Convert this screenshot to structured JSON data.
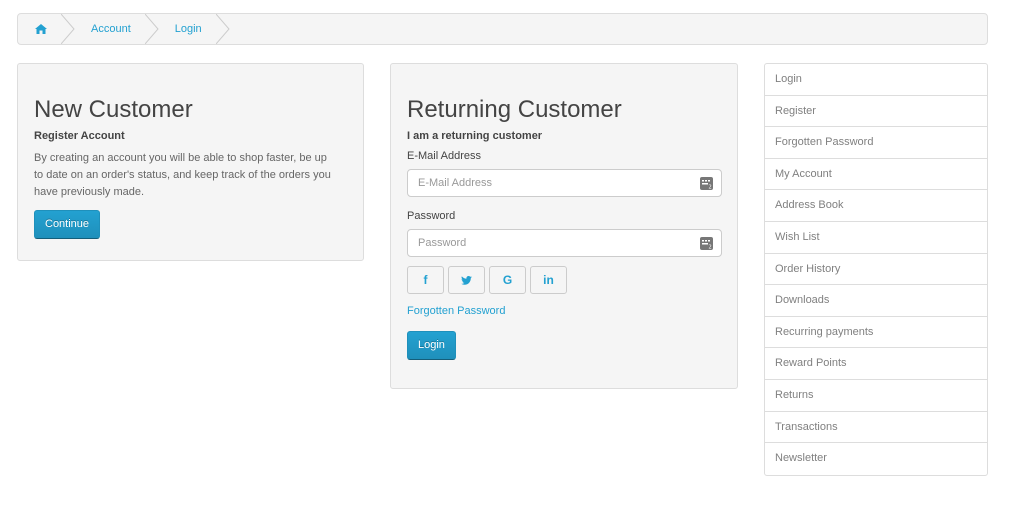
{
  "breadcrumb": {
    "home_icon": "home-icon",
    "items": [
      "Account",
      "Login"
    ]
  },
  "new_customer": {
    "title": "New Customer",
    "subtitle": "Register Account",
    "description": "By creating an account you will be able to shop faster, be up to date on an order's status, and keep track of the orders you have previously made.",
    "continue_label": "Continue"
  },
  "returning_customer": {
    "title": "Returning Customer",
    "subtitle": "I am a returning customer",
    "email_label": "E-Mail Address",
    "email_placeholder": "E-Mail Address",
    "password_label": "Password",
    "password_placeholder": "Password",
    "social": {
      "facebook": "f",
      "twitter": "twitter-icon",
      "google": "G",
      "linkedin": "in"
    },
    "forgotten_label": "Forgotten Password",
    "login_label": "Login"
  },
  "sidebar": {
    "items": [
      "Login",
      "Register",
      "Forgotten Password",
      "My Account",
      "Address Book",
      "Wish List",
      "Order History",
      "Downloads",
      "Recurring payments",
      "Reward Points",
      "Returns",
      "Transactions",
      "Newsletter"
    ]
  },
  "colors": {
    "accent": "#23a1d1",
    "panel_bg": "#f5f5f5",
    "border": "#dddddd"
  }
}
